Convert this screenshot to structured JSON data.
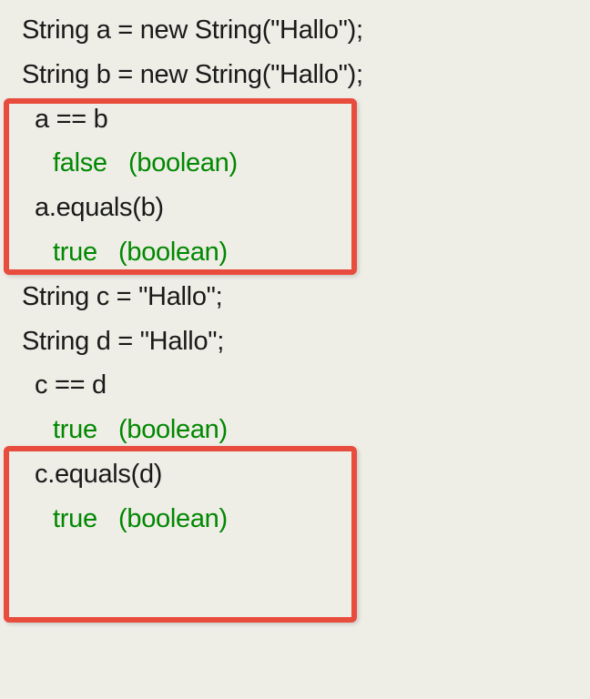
{
  "line1": "String a = new String(\"Hallo\");",
  "line2": "String b = new String(\"Hallo\");",
  "expr1": "a == b",
  "result1": "false   (boolean)",
  "expr2": "a.equals(b)",
  "result2": "true   (boolean)",
  "line3": "String c = \"Hallo\";",
  "line4": "String d = \"Hallo\";",
  "expr3": "c == d",
  "result3": "true   (boolean)",
  "expr4": "c.equals(d)",
  "result4": "true   (boolean)"
}
